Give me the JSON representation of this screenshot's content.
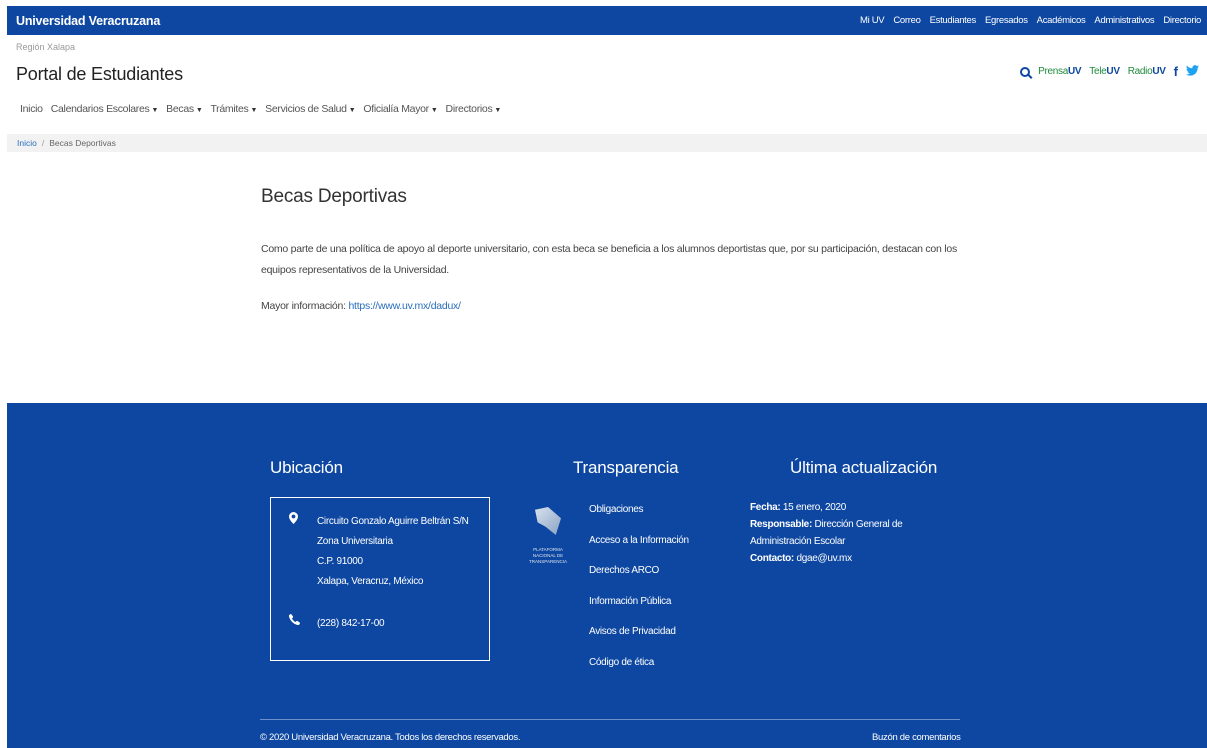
{
  "topbar": {
    "brand": "Universidad Veracruzana",
    "links": [
      "Mi UV",
      "Correo",
      "Estudiantes",
      "Egresados",
      "Académicos",
      "Administrativos",
      "Directorio"
    ]
  },
  "header": {
    "region": "Región Xalapa",
    "title": "Portal de Estudiantes",
    "social": {
      "prensa_a": "Prensa",
      "prensa_b": "UV",
      "tele_a": "Tele",
      "tele_b": "UV",
      "radio_a": "Radio",
      "radio_b": "UV"
    }
  },
  "nav": {
    "items": [
      {
        "label": "Inicio"
      },
      {
        "label": "Calendarios Escolares"
      },
      {
        "label": "Becas"
      },
      {
        "label": "Trámites"
      },
      {
        "label": "Servicios de Salud"
      },
      {
        "label": "Oficialía Mayor"
      },
      {
        "label": "Directorios"
      }
    ]
  },
  "breadcrumb": {
    "home": "Inicio",
    "separator": "/",
    "current": "Becas Deportivas"
  },
  "content": {
    "title": "Becas Deportivas",
    "paragraph": "Como parte de una política de apoyo al deporte universitario, con esta beca se beneficia a los alumnos deportistas que, por su participación, destacan con los equipos representativos de la Universidad.",
    "more_label": "Mayor información:",
    "more_link": "https://www.uv.mx/dadux/"
  },
  "footer": {
    "location_heading": "Ubicación",
    "address": [
      "Circuito Gonzalo Aguirre Beltrán S/N",
      "Zona Universitaria",
      "C.P. 91000",
      "Xalapa, Veracruz, México"
    ],
    "phone": "(228) 842-17-00",
    "transparency_heading": "Transparencia",
    "pnt_logo_text": [
      "PLATAFORMA",
      "NACIONAL DE",
      "TRANSPARENCIA"
    ],
    "transparency_links": [
      "Obligaciones",
      "Acceso a la Información",
      "Derechos ARCO",
      "Información Pública",
      "Avisos de Privacidad",
      "Código de ética"
    ],
    "update_heading": "Última actualización",
    "fecha_label": "Fecha:",
    "fecha_value": "15 enero, 2020",
    "responsable_label": "Responsable:",
    "responsable_value": "Dirección General de Administración Escolar",
    "contacto_label": "Contacto:",
    "contacto_value": "dgae@uv.mx",
    "copyright": "© 2020 Universidad Veracruzana. Todos los derechos reservados.",
    "buzon": "Buzón de comentarios"
  },
  "colors": {
    "primary": "#0d47a1",
    "link": "#2a6ebb",
    "twitter": "#1da1f2",
    "green": "#1e8a3c"
  }
}
